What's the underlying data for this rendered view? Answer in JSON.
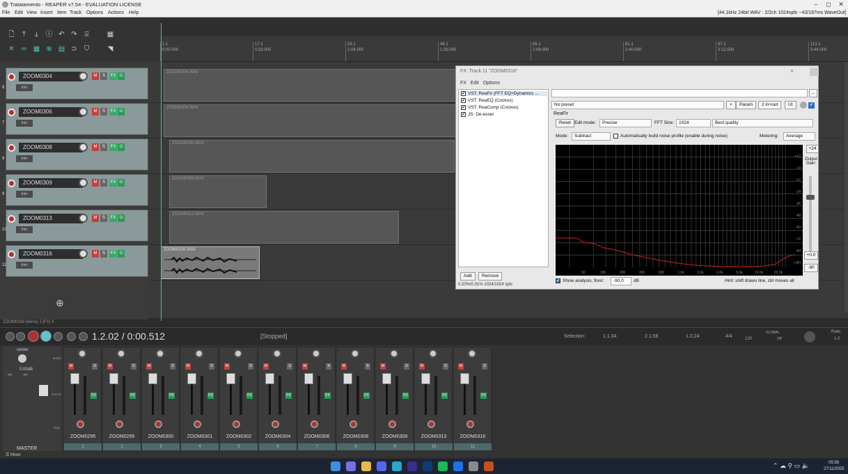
{
  "window": {
    "title": "Tratatamento - REAPER v7.54 - EVALUATION LICENSE",
    "minimize": "–",
    "maximize": "◻",
    "close": "✕"
  },
  "menu": {
    "items": [
      "File",
      "Edit",
      "View",
      "Insert",
      "Item",
      "Track",
      "Options",
      "Actions",
      "Help"
    ],
    "format_info": "[44.1kHz 24bit WAV : 2/2ch 1024spls ~43/187ms WaveOut]"
  },
  "ruler": {
    "marks": [
      {
        "bar": "1.1",
        "time": "0:00.000"
      },
      {
        "bar": "17.1",
        "time": "0:32.000"
      },
      {
        "bar": "33.1",
        "time": "1:04.000"
      },
      {
        "bar": "49.1",
        "time": "1:36.000"
      },
      {
        "bar": "65.1",
        "time": "2:08.000"
      },
      {
        "bar": "81.1",
        "time": "2:40.000"
      },
      {
        "bar": "97.1",
        "time": "3:12.000"
      },
      {
        "bar": "113.1",
        "time": "3:44.000"
      }
    ]
  },
  "tracks": [
    {
      "name": "ZOOM0304",
      "num": "8",
      "trim": "trim",
      "clip": "ZOOM0304.WAV"
    },
    {
      "name": "ZOOM0306",
      "num": "7",
      "trim": "trim",
      "clip": "ZOOM0306.WAV"
    },
    {
      "name": "ZOOM0308",
      "num": "8",
      "trim": "trim",
      "clip": "ZOOM0308.WAV"
    },
    {
      "name": "ZOOM0309",
      "num": "9",
      "trim": "trim",
      "clip": "ZOOM0309.WAV"
    },
    {
      "name": "ZOOM0313",
      "num": "10",
      "trim": "trim",
      "clip": "ZOOM0313.WAV"
    },
    {
      "name": "ZOOM0316",
      "num": "11",
      "trim": "trim",
      "clip": "ZOOM0316.WAV"
    }
  ],
  "track_buttons": {
    "mute": "M",
    "solo": "S",
    "fx": "FX"
  },
  "add_track": "⊕",
  "status_left": "ZOOM0316 [items] 1 [FX] 4",
  "fx": {
    "title": "FX: Track 11 \"ZOOM0316\"",
    "menu": [
      "FX",
      "Edit",
      "Options"
    ],
    "plugins": [
      "VST: ReaFir (FFT EQ+Dynamics ...",
      "VST: ReaEQ (Cockos)",
      "VST: ReaComp (Cockos)",
      "JS: De-esser"
    ],
    "add": "Add",
    "remove": "Remove",
    "cpu": "0.20%/0.31% 1024/1024 spls",
    "preset": "No preset",
    "plus": "+",
    "param": "Param",
    "io": "2 in+out",
    "ui": "UI",
    "plugin_name": "ReaFir",
    "reset": "Reset",
    "edit_mode_label": "Edit mode:",
    "edit_mode": "Precise",
    "fft_label": "FFT Size:",
    "fft_size": "1024",
    "quality": "Best quality",
    "mode_label": "Mode:",
    "mode": "Subtract",
    "auto_noise": "Automatically build noise profile (enable during noise)",
    "metering_label": "Metering:",
    "metering": "Average",
    "db_scale": [
      "+12",
      "+0",
      "-12",
      "-24",
      "-36",
      "-48",
      "-60",
      "-72",
      "-84",
      "(-90)"
    ],
    "freq_scale": [
      "50",
      "100",
      "200",
      "300",
      "500",
      "1.0k",
      "2.0k",
      "3.0k",
      "5.0k",
      "10.0k",
      "20.0k"
    ],
    "gain_top": "+24",
    "output_gain": "Output Gain:",
    "gain_value": "+0.0",
    "gain_min": "-90",
    "show_analysis": "Show analysis, floor:",
    "floor": "-90.0",
    "db": "dB",
    "hint": "Hint: shift draws line, ctrl moves all"
  },
  "transport": {
    "position": "1.2.02 / 0:00.512",
    "state": "[Stopped]",
    "selection_label": "Selection:",
    "sel_start": "1.1.34",
    "sel_end": "2.1.58",
    "sel_len": "1.0.24",
    "timesig": "4/4",
    "bpm": "120",
    "rate_label": "Rate:",
    "rate": "1.0",
    "global": "GLOBAL",
    "off": "Off"
  },
  "master": {
    "label": "MASTER",
    "pan": "center",
    "vol": "0.00dB",
    "peak_l": "-inf",
    "peak_r": "-inf",
    "mono": "MONO",
    "route": "ROUTE",
    "trim": "TRIM"
  },
  "mixer": [
    {
      "name": "ZOOM0295",
      "num": "1"
    },
    {
      "name": "ZOOM0299",
      "num": "2"
    },
    {
      "name": "ZOOM0300",
      "num": "3"
    },
    {
      "name": "ZOOM0301",
      "num": "4"
    },
    {
      "name": "ZOOM0302",
      "num": "5"
    },
    {
      "name": "ZOOM0304",
      "num": "6"
    },
    {
      "name": "ZOOM0306",
      "num": "7"
    },
    {
      "name": "ZOOM0308",
      "num": "8"
    },
    {
      "name": "ZOOM0309",
      "num": "9"
    },
    {
      "name": "ZOOM0313",
      "num": "10"
    },
    {
      "name": "ZOOM0316",
      "num": "11"
    }
  ],
  "mixer_tab": "Mixer",
  "taskbar": {
    "time": "05:58",
    "date": "27/11/2025"
  },
  "colors": {
    "accent": "#4db6c4",
    "mute": "#c24141",
    "fx": "#2e9a5a",
    "curve": "#d21e1e"
  }
}
